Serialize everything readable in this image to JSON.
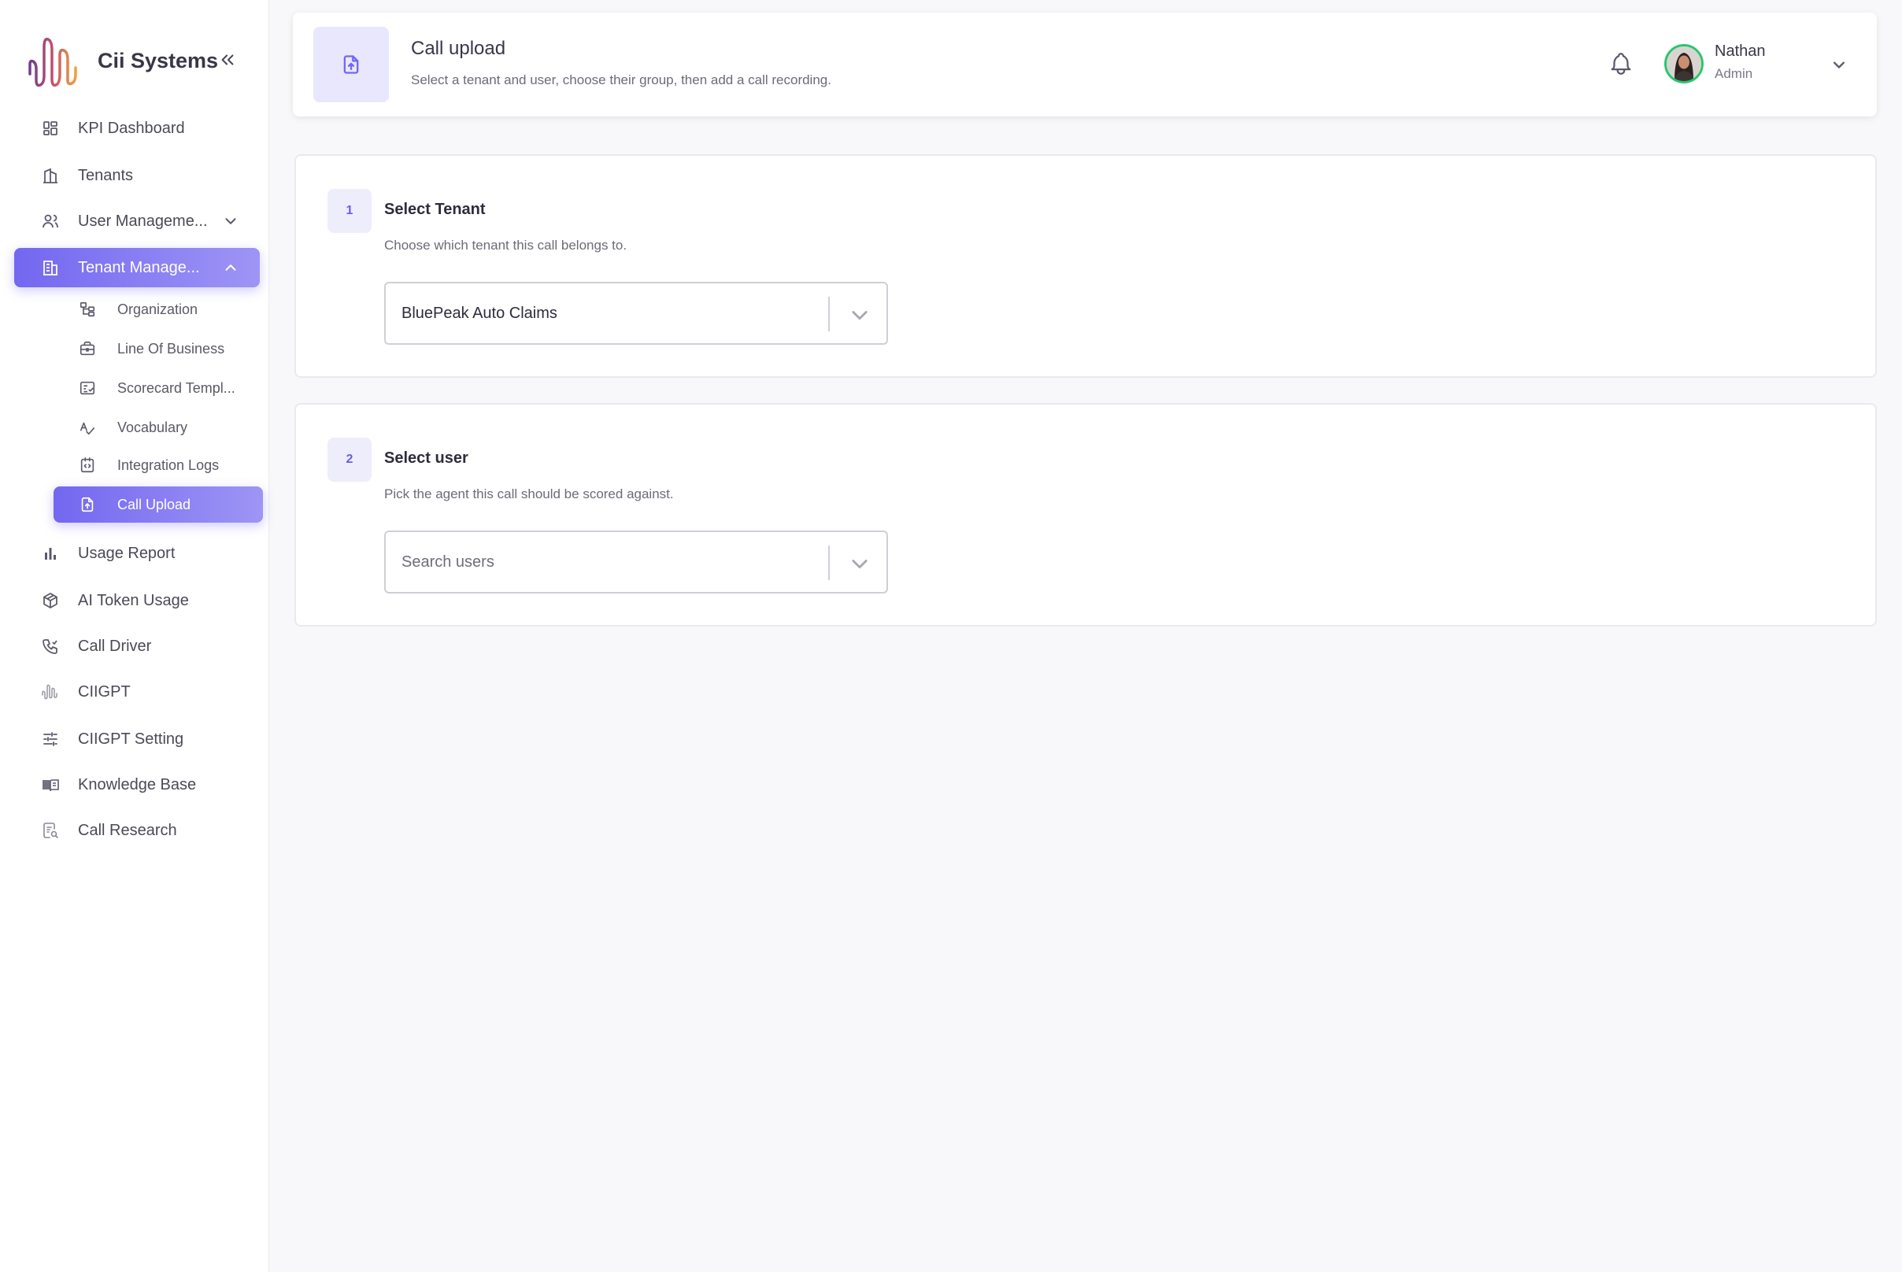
{
  "brand": {
    "name": "Cii Systems"
  },
  "sidebar": {
    "items": [
      {
        "label": "KPI Dashboard",
        "icon": "dashboard-icon"
      },
      {
        "label": "Tenants",
        "icon": "buildings-icon"
      },
      {
        "label": "User Manageme...",
        "icon": "users-icon"
      },
      {
        "label": "Tenant Manage...",
        "icon": "building-icon"
      },
      {
        "label": "Usage Report",
        "icon": "bar-chart-icon"
      },
      {
        "label": "AI Token Usage",
        "icon": "cube-icon"
      },
      {
        "label": "Call Driver",
        "icon": "phone-icon"
      },
      {
        "label": "CIIGPT",
        "icon": "waveform-icon"
      },
      {
        "label": "CIIGPT Setting",
        "icon": "sliders-icon"
      },
      {
        "label": "Knowledge Base",
        "icon": "book-icon"
      },
      {
        "label": "Call Research",
        "icon": "report-search-icon"
      }
    ],
    "sub_items": [
      {
        "label": "Organization",
        "icon": "hierarchy-icon"
      },
      {
        "label": "Line Of Business",
        "icon": "briefcase-icon"
      },
      {
        "label": "Scorecard Templ...",
        "icon": "checklist-icon"
      },
      {
        "label": "Vocabulary",
        "icon": "spell-check-icon"
      },
      {
        "label": "Integration Logs",
        "icon": "code-icon"
      },
      {
        "label": "Call Upload",
        "icon": "file-upload-icon"
      }
    ]
  },
  "header": {
    "title": "Call upload",
    "subtitle": "Select a tenant and user, choose their group, then add a call recording.",
    "user_name": "Nathan",
    "user_role": "Admin"
  },
  "steps": [
    {
      "number": "1",
      "title": "Select Tenant",
      "description": "Choose which tenant this call belongs to.",
      "selected_value": "BluePeak Auto Claims"
    },
    {
      "number": "2",
      "title": "Select user",
      "description": "Pick the agent this call should be scored against.",
      "placeholder": "Search users"
    }
  ],
  "colors": {
    "accent": "#7367f0",
    "accent_light": "#e8e7fd",
    "online": "#28c76f"
  }
}
